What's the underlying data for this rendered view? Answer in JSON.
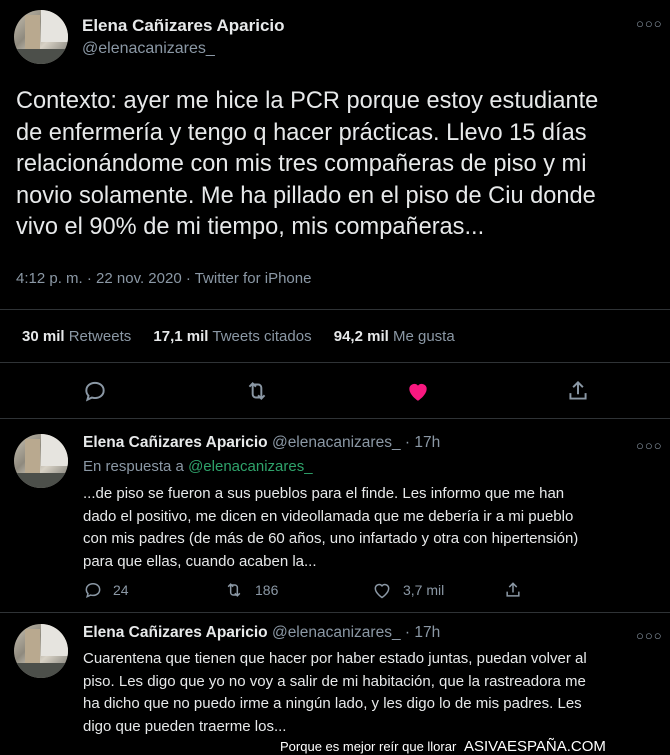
{
  "main_tweet": {
    "author_name": "Elena Cañizares Aparicio",
    "handle": "@elenacanizares_",
    "text_lines": [
      "Contexto: ayer me hice la PCR porque estoy estudiante",
      "de enfermería y tengo q hacer prácticas. Llevo 15 días",
      "relacionándome con mis tres compañeras de piso y mi",
      "novio solamente. Me ha pillado en el piso de Ciu donde",
      "vivo el 90% de mi tiempo, mis compañeras..."
    ],
    "meta": "4:12 p. m. · 22 nov. 2020 · Twitter for iPhone",
    "stats": {
      "retweets_count": "30 mil",
      "retweets_label": "Retweets",
      "quotes_count": "17,1 mil",
      "quotes_label": "Tweets citados",
      "likes_count": "94,2 mil",
      "likes_label": "Me gusta"
    },
    "liked": true,
    "like_color": "#f91880"
  },
  "replies": [
    {
      "author_name": "Elena Cañizares Aparicio",
      "handle_time": "@elenacanizares_ · 17h",
      "in_reply_prefix": "En respuesta a",
      "in_reply_handle": "@elenacanizares_",
      "text_lines": [
        "...de piso se fueron a sus pueblos para el finde. Les informo que me han",
        "dado el positivo, me dicen en videollamada que me debería ir a mi pueblo",
        "con mis padres (de más de 60 años, uno infartado y otra con hipertensión)",
        "para que ellas, cuando acaben la..."
      ],
      "replies_count": "24",
      "retweets_count": "186",
      "likes_count": "3,7 mil"
    },
    {
      "author_name": "Elena Cañizares Aparicio",
      "handle_time": "@elenacanizares_ · 17h",
      "text_lines": [
        "Cuarentena que tienen que hacer por haber estado juntas, puedan volver al",
        "piso. Les digo que yo no voy a salir de mi habitación, que la rastreadora me",
        "ha dicho que no puedo irme a ningún lado, y les digo lo de mis padres. Les",
        "digo que pueden traerme los..."
      ]
    }
  ],
  "watermark": {
    "text": "Porque es mejor reír que llorar",
    "site": "ASIVAESPAÑA.COM"
  },
  "colors": {
    "accent_link": "#2fa36b",
    "muted": "#8b98a5"
  }
}
